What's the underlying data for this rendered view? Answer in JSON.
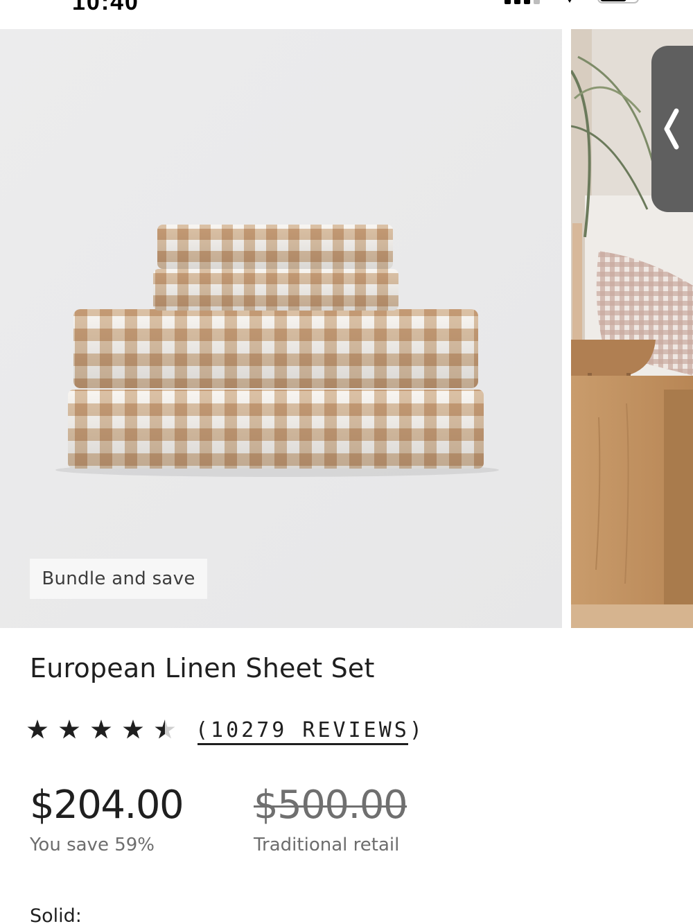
{
  "status_bar": {
    "time": "10:40",
    "signal_icon": "cellular-signal-icon",
    "wifi_icon": "wifi-icon",
    "battery_icon": "battery-icon"
  },
  "gallery": {
    "badge": "Bundle and save",
    "main_image": "gingham-linen-sheet-stack",
    "next_image": "bedroom-scene-with-gingham-pillow",
    "handle_icon": "chevron-left-icon"
  },
  "product": {
    "title": "European Linen Sheet Set",
    "rating": {
      "value": 4.5,
      "max": 5,
      "reviews_label": "(10279 REVIEWS)"
    },
    "price": {
      "current": "$204.00",
      "savings": "You save 59%",
      "original": "$500.00",
      "original_label": "Traditional retail"
    },
    "option_label": "Solid:"
  },
  "colors": {
    "gingham_tan": "#c9a27e",
    "gingham_light": "#dcc2a8",
    "background_gray": "#ebebec",
    "text_dark": "#1f1f1f",
    "text_muted": "#6d6d6d"
  }
}
